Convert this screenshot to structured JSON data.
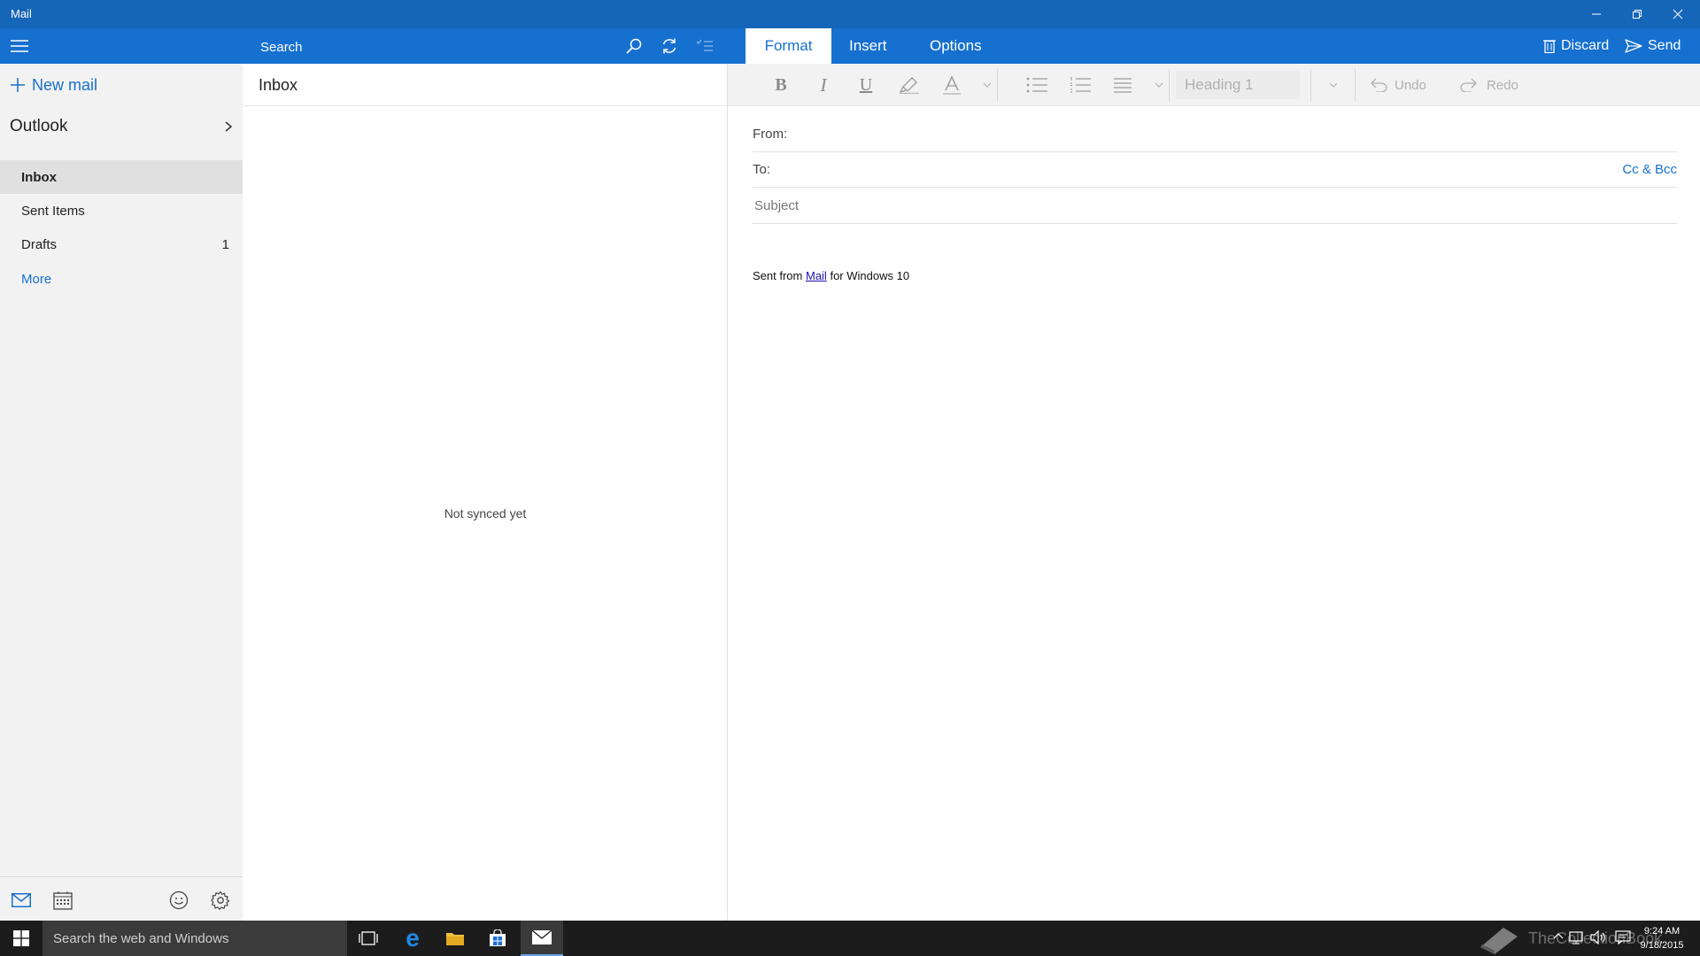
{
  "window": {
    "title": "Mail"
  },
  "sidebar": {
    "new_mail": "New mail",
    "account": "Outlook",
    "folders": [
      {
        "label": "Inbox",
        "count": ""
      },
      {
        "label": "Sent Items",
        "count": ""
      },
      {
        "label": "Drafts",
        "count": "1"
      }
    ],
    "more": "More"
  },
  "message_list": {
    "search_placeholder": "Search",
    "folder_title": "Inbox",
    "empty_state": "Not synced yet"
  },
  "compose": {
    "tabs": [
      "Format",
      "Insert",
      "Options"
    ],
    "active_tab": "Format",
    "discard": "Discard",
    "send": "Send",
    "style_value": "Heading 1",
    "undo": "Undo",
    "redo": "Redo",
    "from_label": "From:",
    "to_label": "To:",
    "cc_bcc": "Cc & Bcc",
    "subject_placeholder": "Subject",
    "signature_pre": "Sent from",
    "signature_link": "Mail",
    "signature_post": "for Windows 10"
  },
  "taskbar": {
    "search_placeholder": "Search the web and Windows",
    "watermark": "TheCollectionBook",
    "time": "9:24 AM",
    "date": "9/18/2015"
  },
  "colors": {
    "accent": "#1670cf",
    "titlebar": "#1565b8",
    "taskbar": "#1c1c1c"
  }
}
